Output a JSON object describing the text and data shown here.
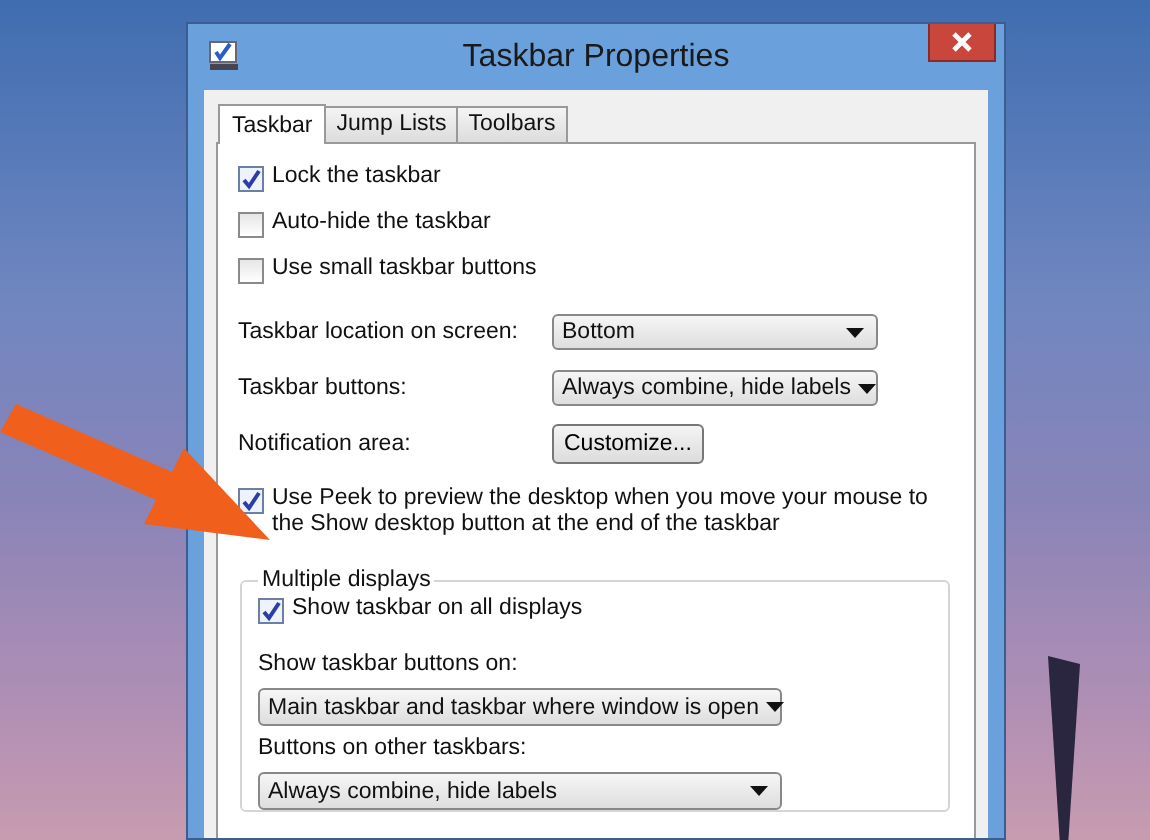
{
  "window": {
    "title": "Taskbar Properties"
  },
  "tabs": [
    {
      "label": "Taskbar",
      "selected": true
    },
    {
      "label": "Jump Lists",
      "selected": false
    },
    {
      "label": "Toolbars",
      "selected": false
    }
  ],
  "options": [
    {
      "kind": "checkbox",
      "label": "Lock the taskbar",
      "checked": true
    },
    {
      "kind": "checkbox",
      "label": "Auto-hide the taskbar",
      "checked": false
    },
    {
      "kind": "checkbox",
      "label": "Use small taskbar buttons",
      "checked": false
    },
    {
      "kind": "select",
      "label": "Taskbar location on screen:",
      "value": "Bottom"
    },
    {
      "kind": "select",
      "label": "Taskbar buttons:",
      "value": "Always combine, hide labels"
    },
    {
      "kind": "button",
      "label": "Notification area:",
      "value": "Customize..."
    },
    {
      "kind": "checkbox",
      "label": "Use Peek to preview the desktop when you move your mouse to the Show desktop button at the end of the taskbar",
      "checked": true
    }
  ],
  "multiple_displays": {
    "title": "Multiple displays",
    "items": [
      {
        "kind": "checkbox",
        "label": "Show taskbar on all displays",
        "checked": true
      },
      {
        "kind": "select",
        "label": "Show taskbar buttons on:",
        "value": "Main taskbar and taskbar where window is open"
      },
      {
        "kind": "select",
        "label": "Buttons on other taskbars:",
        "value": "Always combine, hide labels"
      }
    ]
  }
}
